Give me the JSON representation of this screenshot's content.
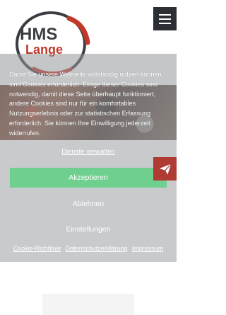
{
  "header": {
    "logo": {
      "line1": "HMS",
      "line2": "Lange",
      "colors": {
        "dark": "#3a3d42",
        "red": "#c0392b"
      }
    },
    "menu_icon": "hamburger-menu-icon"
  },
  "cookie_banner": {
    "message": "Damit Sie unsere Webseite vollständig nutzen können, sind Cookies erforderlich. Einige dieser Cookies sind notwendig, damit diese Seite überhaupt funktioniert, andere Cookies sind nur für ein komfortables Nutzungserlebnis oder zur statistischen Erfassung erforderlich. Sie können Ihre Einwilligung jederzeit widerrufen.",
    "manage_services_label": "Dienste verwalten",
    "accept_label": "Akzeptieren",
    "deny_label": "Ablehnen",
    "settings_label": "Einstellungen",
    "links": {
      "cookie_policy": "Cookie-Richtlinie",
      "privacy": "Datenschutzerklärung",
      "imprint": "Impressum"
    },
    "accent_color": "#6fcf8f"
  },
  "side_tab": {
    "icon": "paper-plane-icon",
    "color": "#b03a34"
  }
}
